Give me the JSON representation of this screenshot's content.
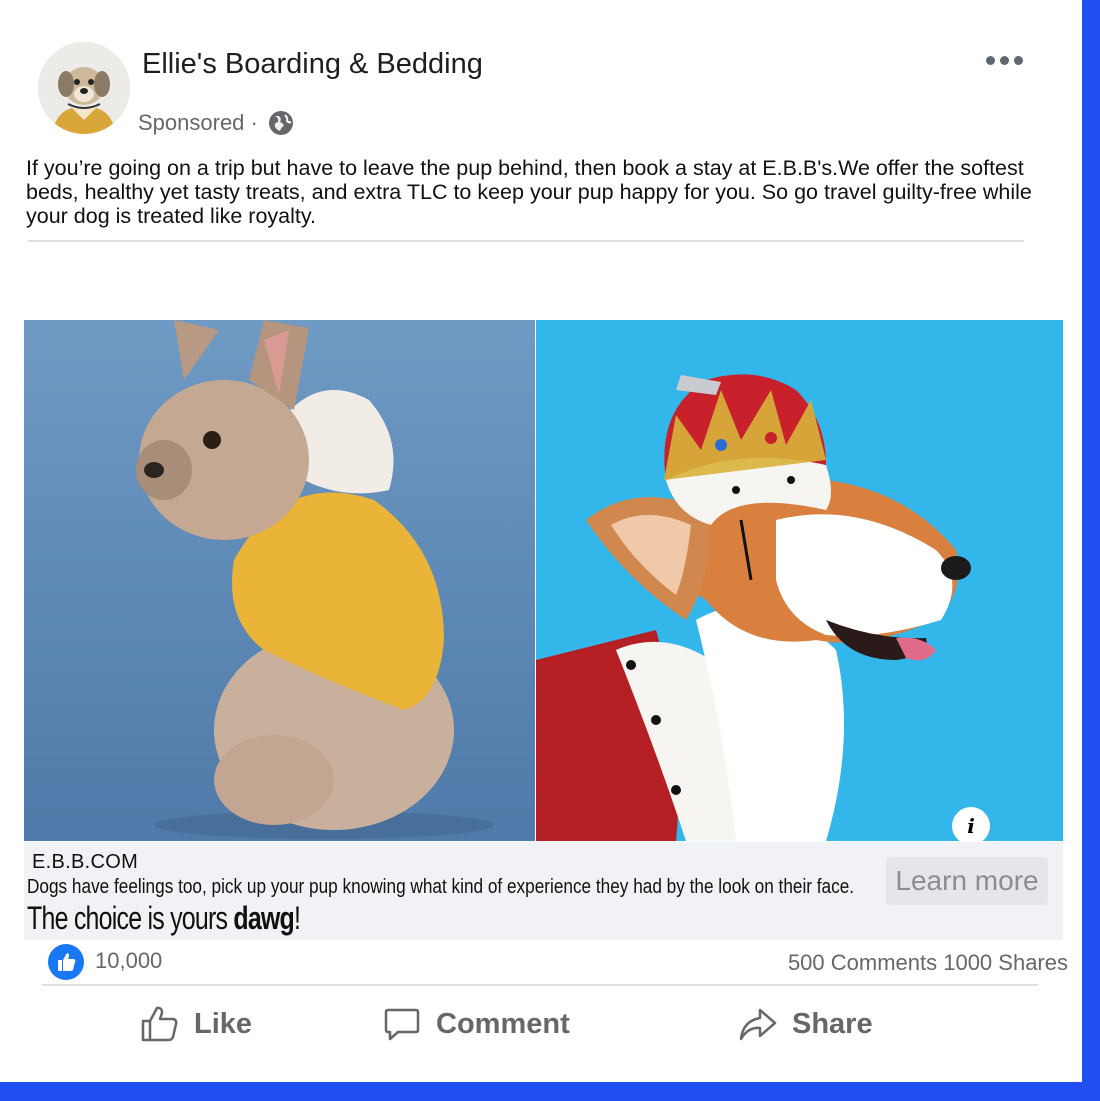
{
  "post": {
    "page_name": "Ellie's Boarding & Bedding",
    "sponsored_label": "Sponsored ·",
    "body_text": "If you’re going on a trip but have to leave the pup behind, then book a stay at E.B.B's.We offer the softest beds, healthy yet tasty treats, and extra TLC to keep your pup happy for you. So go travel guilty-free while your dog is treated like royalty.",
    "icons": {
      "more": "more-options-icon",
      "audience": "globe-icon",
      "info": "info-icon"
    }
  },
  "link_preview": {
    "domain": "E.B.B.COM",
    "description": "Dogs have feelings too, pick up your pup knowing what kind of experience they had by the look on their face.",
    "tagline_prefix": "The choice is yours ",
    "tagline_bold": "dawg",
    "tagline_suffix": "!",
    "cta_label": "Learn more"
  },
  "engagement": {
    "like_count": "10,000",
    "comments_shares": "500 Comments 1000 Shares"
  },
  "actions": [
    {
      "label": "Like",
      "icon": "thumbs-up-icon"
    },
    {
      "label": "Comment",
      "icon": "comment-bubble-icon"
    },
    {
      "label": "Share",
      "icon": "share-arrow-icon"
    }
  ],
  "colors": {
    "frame_accent": "#1f4ff0",
    "like_blue": "#1877f2",
    "link_bar_bg": "#f0f2f5",
    "muted_text": "#65676b"
  }
}
